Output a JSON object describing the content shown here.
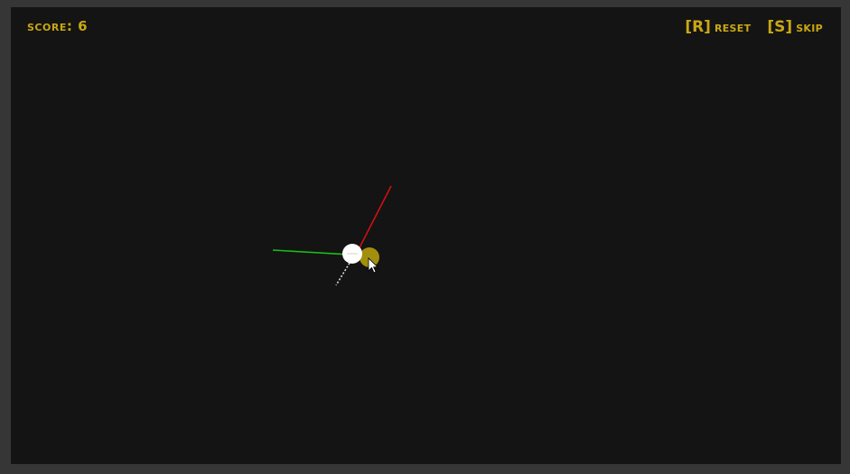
{
  "hud": {
    "score_label": "SCORE:",
    "score_value": "6",
    "reset_key": "[R]",
    "reset_label": "RESET",
    "skip_key": "[S]",
    "skip_label": "SKIP"
  },
  "colors": {
    "background": "#141414",
    "frame": "#363636",
    "hud_text": "#c9a712",
    "red_axis": "#d01010",
    "green_axis": "#18c018",
    "target": "#a38f0e",
    "player": "#ffffff"
  },
  "icons": {
    "pointer": "mouse-cursor-icon"
  }
}
